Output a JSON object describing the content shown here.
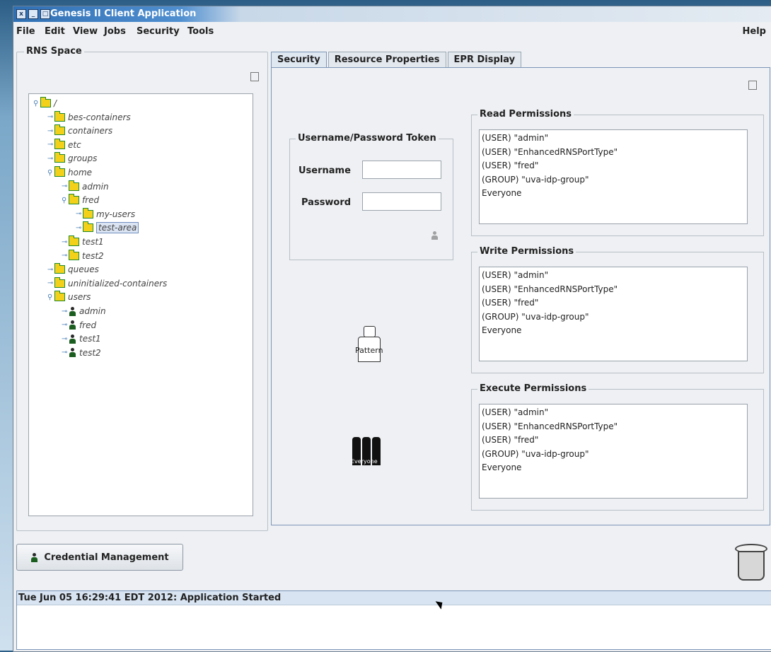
{
  "window": {
    "title": "Genesis II Client Application"
  },
  "menu": {
    "items": [
      "File",
      "Edit",
      "View",
      "Jobs",
      "Security",
      "Tools"
    ],
    "help": "Help"
  },
  "rns": {
    "title": "RNS Space",
    "tree": [
      {
        "label": "/",
        "level": 0,
        "type": "folder",
        "expanded": true
      },
      {
        "label": "bes-containers",
        "level": 1,
        "type": "folder"
      },
      {
        "label": "containers",
        "level": 1,
        "type": "folder"
      },
      {
        "label": "etc",
        "level": 1,
        "type": "folder"
      },
      {
        "label": "groups",
        "level": 1,
        "type": "folder"
      },
      {
        "label": "home",
        "level": 1,
        "type": "folder",
        "expanded": true
      },
      {
        "label": "admin",
        "level": 2,
        "type": "folder"
      },
      {
        "label": "fred",
        "level": 2,
        "type": "folder",
        "expanded": true
      },
      {
        "label": "my-users",
        "level": 3,
        "type": "folder"
      },
      {
        "label": "test-area",
        "level": 3,
        "type": "folder",
        "selected": true
      },
      {
        "label": "test1",
        "level": 2,
        "type": "folder"
      },
      {
        "label": "test2",
        "level": 2,
        "type": "folder"
      },
      {
        "label": "queues",
        "level": 1,
        "type": "folder"
      },
      {
        "label": "uninitialized-containers",
        "level": 1,
        "type": "folder"
      },
      {
        "label": "users",
        "level": 1,
        "type": "folder",
        "expanded": true
      },
      {
        "label": "admin",
        "level": 2,
        "type": "user"
      },
      {
        "label": "fred",
        "level": 2,
        "type": "user"
      },
      {
        "label": "test1",
        "level": 2,
        "type": "user"
      },
      {
        "label": "test2",
        "level": 2,
        "type": "user"
      }
    ]
  },
  "tabs": [
    "Security",
    "Resource Properties",
    "EPR Display"
  ],
  "token": {
    "title": "Username/Password Token",
    "username_label": "Username",
    "password_label": "Password",
    "username_value": "",
    "password_value": ""
  },
  "icons": {
    "pattern_label": "Pattern",
    "everyone_label": "Everyone"
  },
  "permissions": {
    "read": {
      "title": "Read Permissions",
      "entries": [
        "(USER) \"admin\"",
        "(USER) \"EnhancedRNSPortType\"",
        "(USER) \"fred\"",
        "(GROUP) \"uva-idp-group\"",
        "Everyone"
      ]
    },
    "write": {
      "title": "Write Permissions",
      "entries": [
        "(USER) \"admin\"",
        "(USER) \"EnhancedRNSPortType\"",
        "(USER) \"fred\"",
        "(GROUP) \"uva-idp-group\"",
        "Everyone"
      ]
    },
    "execute": {
      "title": "Execute Permissions",
      "entries": [
        "(USER) \"admin\"",
        "(USER) \"EnhancedRNSPortType\"",
        "(USER) \"fred\"",
        "(GROUP) \"uva-idp-group\"",
        "Everyone"
      ]
    }
  },
  "buttons": {
    "credential_management": "Credential Management"
  },
  "status": {
    "message": "Tue Jun 05 16:29:41 EDT 2012: Application Started"
  }
}
